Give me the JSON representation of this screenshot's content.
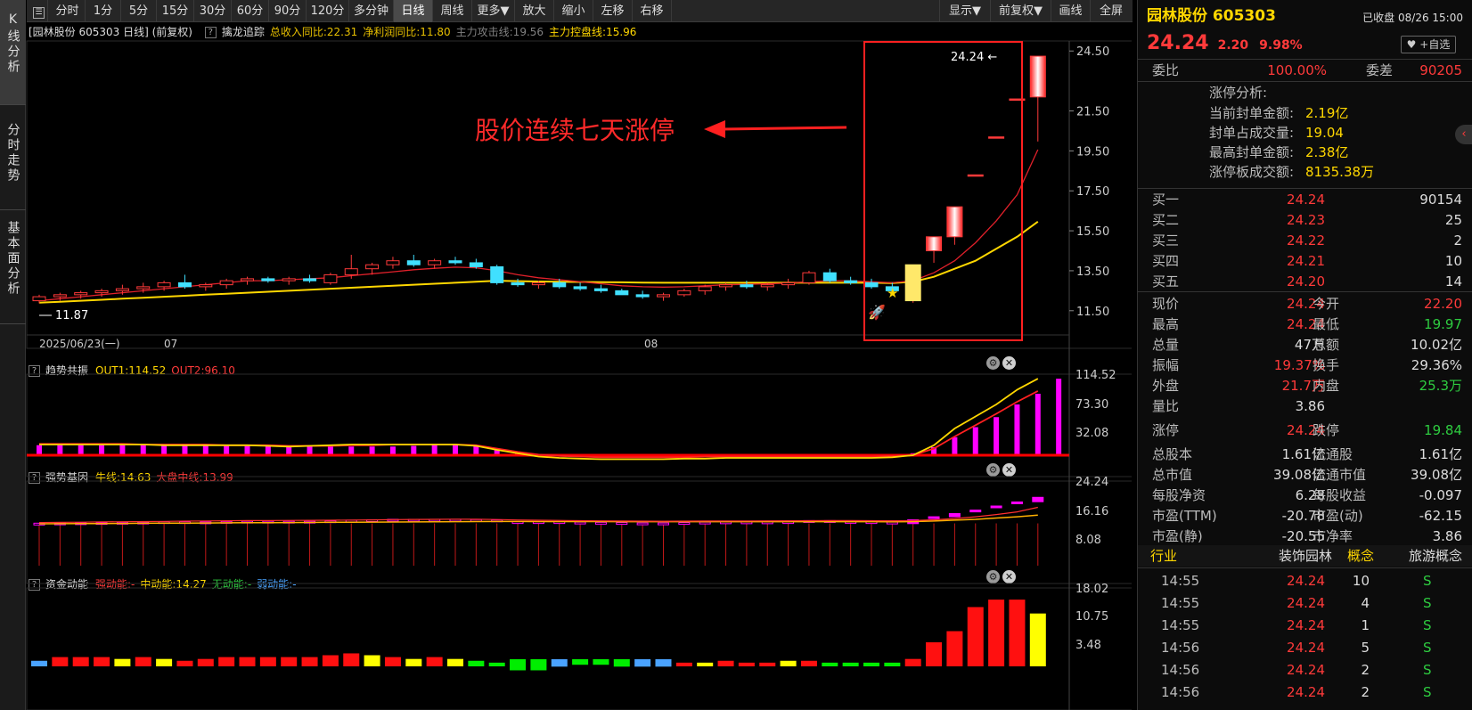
{
  "sidebar": {
    "tabs": [
      {
        "label": "K线分析"
      },
      {
        "label": "分时走势"
      },
      {
        "label": "基本面分析"
      }
    ]
  },
  "toolbar": {
    "periods": [
      "分时",
      "1分",
      "5分",
      "15分",
      "30分",
      "60分",
      "90分",
      "120分",
      "多分钟",
      "日线",
      "周线",
      "更多▼"
    ],
    "active_period": "日线",
    "actions": [
      "放大",
      "缩小",
      "左移",
      "右移"
    ],
    "right_actions": [
      "显示▼",
      "前复权▼",
      "画线",
      "全屏"
    ]
  },
  "kline": {
    "title_prefix": "[园林股份 605303 日线] (前复权)",
    "indicator_name": "擒龙追踪",
    "indicators": [
      {
        "text": "总收入同比:22.31",
        "color": "#e8c000"
      },
      {
        "text": "净利润同比:11.80",
        "color": "#e8c000"
      },
      {
        "text": "主力攻击线:19.56",
        "color": "#808080"
      },
      {
        "text": "主力控盘线:15.96",
        "color": "#ffd700"
      }
    ],
    "annotation": "股价连续七天涨停",
    "high_label": "24.24",
    "low_label": "11.87",
    "date_labels": [
      "2025/06/23(一)",
      "07",
      "08"
    ]
  },
  "panes": [
    {
      "name": "趋势共振",
      "values": [
        {
          "text": "OUT1:114.52",
          "color": "#ffd700"
        },
        {
          "text": "OUT2:96.10",
          "color": "#ff3a3a"
        }
      ],
      "axis": [
        "114.52",
        "73.30",
        "32.08"
      ]
    },
    {
      "name": "强势基因",
      "values": [
        {
          "text": "牛线:14.63",
          "color": "#ffd700"
        },
        {
          "text": "大盘中线:13.99",
          "color": "#ff3a3a"
        }
      ],
      "axis": [
        "24.24",
        "16.16",
        "8.08"
      ]
    },
    {
      "name": "资金动能",
      "values": [
        {
          "text": "强动能:-",
          "color": "#ff3a3a"
        },
        {
          "text": "中动能:14.27",
          "color": "#ffd700"
        },
        {
          "text": "无动能:-",
          "color": "#2ecc40"
        },
        {
          "text": "弱动能:-",
          "color": "#4aa3ff"
        }
      ],
      "axis": [
        "18.02",
        "10.75",
        "3.48"
      ]
    }
  ],
  "chart_data": [
    {
      "type": "candlestick",
      "title": "园林股份 605303 日线",
      "y_ticks": [
        "24.50",
        "21.50",
        "19.50",
        "17.50",
        "15.50",
        "13.50",
        "11.50"
      ],
      "ylim": [
        11.0,
        24.6
      ],
      "x_labels": [
        "2025/06/23(一)",
        "07",
        "08"
      ],
      "candles": [
        {
          "o": 12.0,
          "h": 12.3,
          "l": 11.87,
          "c": 12.2
        },
        {
          "o": 12.2,
          "h": 12.4,
          "l": 12.0,
          "c": 12.3
        },
        {
          "o": 12.3,
          "h": 12.5,
          "l": 12.1,
          "c": 12.4
        },
        {
          "o": 12.4,
          "h": 12.6,
          "l": 12.2,
          "c": 12.5
        },
        {
          "o": 12.5,
          "h": 12.8,
          "l": 12.3,
          "c": 12.6
        },
        {
          "o": 12.6,
          "h": 12.9,
          "l": 12.4,
          "c": 12.7
        },
        {
          "o": 12.7,
          "h": 13.0,
          "l": 12.5,
          "c": 12.9
        },
        {
          "o": 12.9,
          "h": 13.3,
          "l": 12.6,
          "c": 12.7
        },
        {
          "o": 12.7,
          "h": 12.9,
          "l": 12.5,
          "c": 12.8
        },
        {
          "o": 12.8,
          "h": 13.1,
          "l": 12.6,
          "c": 13.0
        },
        {
          "o": 13.0,
          "h": 13.2,
          "l": 12.8,
          "c": 13.1
        },
        {
          "o": 13.1,
          "h": 13.2,
          "l": 12.9,
          "c": 13.0
        },
        {
          "o": 13.0,
          "h": 13.2,
          "l": 12.8,
          "c": 13.1
        },
        {
          "o": 13.1,
          "h": 13.3,
          "l": 12.9,
          "c": 13.0
        },
        {
          "o": 12.9,
          "h": 13.4,
          "l": 12.8,
          "c": 13.3
        },
        {
          "o": 13.3,
          "h": 14.3,
          "l": 13.1,
          "c": 13.6
        },
        {
          "o": 13.6,
          "h": 13.9,
          "l": 13.3,
          "c": 13.8
        },
        {
          "o": 13.8,
          "h": 14.2,
          "l": 13.6,
          "c": 14.0
        },
        {
          "o": 14.0,
          "h": 14.3,
          "l": 13.7,
          "c": 13.8
        },
        {
          "o": 13.8,
          "h": 14.1,
          "l": 13.6,
          "c": 14.0
        },
        {
          "o": 14.0,
          "h": 14.2,
          "l": 13.8,
          "c": 13.9
        },
        {
          "o": 13.9,
          "h": 14.1,
          "l": 13.6,
          "c": 13.7
        },
        {
          "o": 13.7,
          "h": 13.8,
          "l": 12.8,
          "c": 12.9
        },
        {
          "o": 12.9,
          "h": 13.1,
          "l": 12.7,
          "c": 12.8
        },
        {
          "o": 12.8,
          "h": 13.0,
          "l": 12.6,
          "c": 12.9
        },
        {
          "o": 12.9,
          "h": 13.1,
          "l": 12.6,
          "c": 12.7
        },
        {
          "o": 12.7,
          "h": 12.9,
          "l": 12.5,
          "c": 12.6
        },
        {
          "o": 12.6,
          "h": 12.8,
          "l": 12.4,
          "c": 12.5
        },
        {
          "o": 12.5,
          "h": 12.6,
          "l": 12.3,
          "c": 12.3
        },
        {
          "o": 12.3,
          "h": 12.5,
          "l": 12.1,
          "c": 12.2
        },
        {
          "o": 12.2,
          "h": 12.4,
          "l": 12.0,
          "c": 12.3
        },
        {
          "o": 12.3,
          "h": 12.6,
          "l": 12.2,
          "c": 12.5
        },
        {
          "o": 12.5,
          "h": 12.8,
          "l": 12.3,
          "c": 12.7
        },
        {
          "o": 12.7,
          "h": 12.9,
          "l": 12.5,
          "c": 12.8
        },
        {
          "o": 12.8,
          "h": 13.0,
          "l": 12.6,
          "c": 12.7
        },
        {
          "o": 12.7,
          "h": 12.9,
          "l": 12.5,
          "c": 12.8
        },
        {
          "o": 12.8,
          "h": 13.1,
          "l": 12.6,
          "c": 12.9
        },
        {
          "o": 12.9,
          "h": 13.5,
          "l": 12.8,
          "c": 13.4
        },
        {
          "o": 13.4,
          "h": 13.6,
          "l": 12.9,
          "c": 13.0
        },
        {
          "o": 13.0,
          "h": 13.2,
          "l": 12.8,
          "c": 12.9
        },
        {
          "o": 12.9,
          "h": 13.1,
          "l": 12.6,
          "c": 12.7
        },
        {
          "o": 12.7,
          "h": 12.9,
          "l": 12.4,
          "c": 12.5
        },
        {
          "o": 12.0,
          "h": 13.8,
          "l": 11.9,
          "c": 13.8
        },
        {
          "o": 14.5,
          "h": 15.2,
          "l": 13.9,
          "c": 15.2
        },
        {
          "o": 15.2,
          "h": 16.7,
          "l": 14.8,
          "c": 16.7
        },
        {
          "o": 18.3,
          "h": 18.3,
          "l": 18.3,
          "c": 18.3
        },
        {
          "o": 20.2,
          "h": 20.2,
          "l": 20.2,
          "c": 20.2
        },
        {
          "o": 22.1,
          "h": 22.1,
          "l": 22.1,
          "c": 22.1
        },
        {
          "o": 22.2,
          "h": 24.24,
          "l": 19.97,
          "c": 24.24
        }
      ],
      "ma_red": [
        12.0,
        12.1,
        12.2,
        12.3,
        12.4,
        12.5,
        12.6,
        12.7,
        12.8,
        12.9,
        13.0,
        13.0,
        13.05,
        13.1,
        13.15,
        13.25,
        13.35,
        13.45,
        13.55,
        13.62,
        13.68,
        13.65,
        13.5,
        13.3,
        13.15,
        13.05,
        12.95,
        12.85,
        12.75,
        12.7,
        12.68,
        12.7,
        12.75,
        12.8,
        12.82,
        12.85,
        12.88,
        12.95,
        13.0,
        13.0,
        12.95,
        12.9,
        13.0,
        13.4,
        14.0,
        14.9,
        16.0,
        17.3,
        19.56
      ],
      "ma_yellow": [
        11.9,
        11.95,
        12.0,
        12.05,
        12.1,
        12.15,
        12.2,
        12.25,
        12.3,
        12.35,
        12.4,
        12.45,
        12.5,
        12.55,
        12.6,
        12.65,
        12.7,
        12.75,
        12.8,
        12.85,
        12.9,
        12.95,
        13.0,
        12.98,
        12.96,
        12.95,
        12.94,
        12.93,
        12.92,
        12.91,
        12.9,
        12.9,
        12.9,
        12.9,
        12.9,
        12.9,
        12.9,
        12.9,
        12.9,
        12.9,
        12.9,
        12.88,
        12.95,
        13.2,
        13.6,
        14.0,
        14.6,
        15.2,
        15.96
      ]
    },
    {
      "type": "line+bar",
      "title": "趋势共振",
      "ylim": [
        0,
        120
      ],
      "bars": [
        15,
        15,
        15,
        15,
        15,
        15,
        15,
        15,
        15,
        15,
        15,
        15,
        14,
        14,
        13,
        13,
        13,
        13,
        14,
        15,
        15,
        14,
        8,
        4,
        2,
        0,
        0,
        0,
        0,
        0,
        0,
        0,
        0,
        0,
        0,
        0,
        0,
        0,
        0,
        0,
        0,
        0,
        3,
        12,
        27,
        42,
        57,
        76,
        92,
        114.52
      ],
      "out1": [
        16,
        16,
        16,
        16,
        16,
        16,
        15,
        15,
        15,
        15,
        15,
        14,
        13,
        14,
        15,
        16,
        16,
        16,
        16,
        16,
        16,
        14,
        8,
        3,
        -2,
        -4,
        -5,
        -6,
        -6,
        -6,
        -6,
        -5,
        -5,
        -4,
        -4,
        -4,
        -4,
        -4,
        -4,
        -4,
        -4,
        -3,
        0,
        15,
        40,
        58,
        76,
        98,
        114.52
      ],
      "out2": [
        17,
        17,
        17,
        17,
        17,
        16,
        16,
        16,
        16,
        15,
        15,
        15,
        14,
        14,
        14,
        15,
        15,
        16,
        16,
        16,
        16,
        15,
        10,
        5,
        1,
        -1,
        -2,
        -3,
        -3,
        -3,
        -3,
        -3,
        -2,
        -2,
        -2,
        -2,
        -2,
        -2,
        -2,
        -2,
        -2,
        -1,
        0,
        10,
        28,
        45,
        62,
        80,
        96.1
      ]
    },
    {
      "type": "candlestick+bar",
      "title": "强势基因",
      "ylim": [
        0,
        26
      ],
      "bar_heights": [
        13,
        13,
        13,
        13,
        13,
        13,
        13,
        13,
        13,
        13,
        13,
        13,
        13,
        13,
        13,
        13,
        13,
        13,
        13,
        13,
        13,
        13,
        13,
        13,
        13,
        13,
        13,
        13,
        13,
        13,
        13,
        13,
        13,
        13,
        13,
        13,
        13,
        13,
        13,
        13,
        13,
        13,
        13,
        13,
        13,
        13,
        13,
        13,
        13
      ],
      "bull_line": 14.63,
      "market_mid_line": 13.99
    },
    {
      "type": "bar",
      "title": "资金动能",
      "ylim": [
        0,
        19
      ],
      "values": [
        1.5,
        2.5,
        2.5,
        2.5,
        2.0,
        2.5,
        2.0,
        1.5,
        2.0,
        2.5,
        2.5,
        2.5,
        2.5,
        2.5,
        3.0,
        3.5,
        3.0,
        2.5,
        2.0,
        2.5,
        2.0,
        1.5,
        1.0,
        -3.0,
        -3.0,
        -2.0,
        -1.5,
        -1.5,
        -2.0,
        -2.0,
        -2.0,
        1.0,
        1.0,
        1.5,
        1.0,
        1.0,
        1.5,
        1.5,
        1.0,
        1.0,
        1.0,
        1.0,
        2.0,
        6.5,
        9.5,
        16.0,
        18.02,
        18.02,
        14.27
      ],
      "colors": [
        "blue",
        "red",
        "red",
        "red",
        "yellow",
        "red",
        "yellow",
        "red",
        "red",
        "red",
        "red",
        "red",
        "red",
        "red",
        "red",
        "red",
        "yellow",
        "red",
        "yellow",
        "red",
        "yellow",
        "green",
        "green",
        "green",
        "green",
        "blue",
        "green",
        "green",
        "green",
        "blue",
        "blue",
        "red",
        "yellow",
        "red",
        "red",
        "red",
        "yellow",
        "red",
        "green",
        "green",
        "green",
        "green",
        "red",
        "red",
        "red",
        "red",
        "red",
        "red",
        "yellow"
      ]
    }
  ],
  "quote": {
    "name": "园林股份",
    "code": "605303",
    "status": "已收盘",
    "time": "08/26 15:00",
    "price": "24.24",
    "change": "2.20",
    "pct": "9.98%",
    "watch_btn": "+自选",
    "weibi_label": "委比",
    "weibi": "100.00%",
    "weicha_label": "委差",
    "weicha": "90205",
    "limit_title": "涨停分析:",
    "limit_rows": [
      {
        "label": "当前封单金额:",
        "value": "2.19亿"
      },
      {
        "label": "封单占成交量:",
        "value": "19.04"
      },
      {
        "label": "最高封单金额:",
        "value": "2.38亿"
      },
      {
        "label": "涨停板成交额:",
        "value": "8135.38万"
      }
    ],
    "bids": [
      {
        "label": "买一",
        "price": "24.24",
        "vol": "90154"
      },
      {
        "label": "买二",
        "price": "24.23",
        "vol": "25"
      },
      {
        "label": "买三",
        "price": "24.22",
        "vol": "2"
      },
      {
        "label": "买四",
        "price": "24.21",
        "vol": "10"
      },
      {
        "label": "买五",
        "price": "24.20",
        "vol": "14"
      }
    ],
    "stats": [
      {
        "l1": "现价",
        "v1": "24.24",
        "c1": "red",
        "l2": "今开",
        "v2": "22.20",
        "c2": "red"
      },
      {
        "l1": "最高",
        "v1": "24.24",
        "c1": "red",
        "l2": "最低",
        "v2": "19.97",
        "c2": "green"
      },
      {
        "l1": "总量",
        "v1": "47万",
        "c1": "white",
        "l2": "总额",
        "v2": "10.02亿",
        "c2": "white"
      },
      {
        "l1": "振幅",
        "v1": "19.37%",
        "c1": "red",
        "l2": "换手",
        "v2": "29.36%",
        "c2": "white"
      },
      {
        "l1": "外盘",
        "v1": "21.7万",
        "c1": "red",
        "l2": "内盘",
        "v2": "25.3万",
        "c2": "green"
      },
      {
        "l1": "量比",
        "v1": "3.86",
        "c1": "white",
        "l2": "",
        "v2": "",
        "c2": "white"
      },
      {
        "l1": "涨停",
        "v1": "24.24",
        "c1": "red",
        "l2": "跌停",
        "v2": "19.84",
        "c2": "green"
      },
      {
        "l1": "总股本",
        "v1": "1.61亿",
        "c1": "white",
        "l2": "流通股",
        "v2": "1.61亿",
        "c2": "white"
      },
      {
        "l1": "总市值",
        "v1": "39.08亿",
        "c1": "white",
        "l2": "流通市值",
        "v2": "39.08亿",
        "c2": "white"
      },
      {
        "l1": "每股净资",
        "v1": "6.28",
        "c1": "white",
        "l2": "每股收益",
        "v2": "-0.097",
        "c2": "white"
      },
      {
        "l1": "市盈(TTM)",
        "v1": "-20.78",
        "c1": "white",
        "l2": "市盈(动)",
        "v2": "-62.15",
        "c2": "white"
      },
      {
        "l1": "市盈(静)",
        "v1": "-20.55",
        "c1": "white",
        "l2": "市净率",
        "v2": "3.86",
        "c2": "white"
      }
    ],
    "industry_label": "行业",
    "industry": "装饰园林",
    "concept_label": "概念",
    "concept": "旅游概念",
    "ticks": [
      {
        "time": "14:55",
        "price": "24.24",
        "vol": "10",
        "bs": "S"
      },
      {
        "time": "14:55",
        "price": "24.24",
        "vol": "4",
        "bs": "S"
      },
      {
        "time": "14:55",
        "price": "24.24",
        "vol": "1",
        "bs": "S"
      },
      {
        "time": "14:56",
        "price": "24.24",
        "vol": "5",
        "bs": "S"
      },
      {
        "time": "14:56",
        "price": "24.24",
        "vol": "2",
        "bs": "S"
      },
      {
        "time": "14:56",
        "price": "24.24",
        "vol": "2",
        "bs": "S"
      }
    ]
  }
}
